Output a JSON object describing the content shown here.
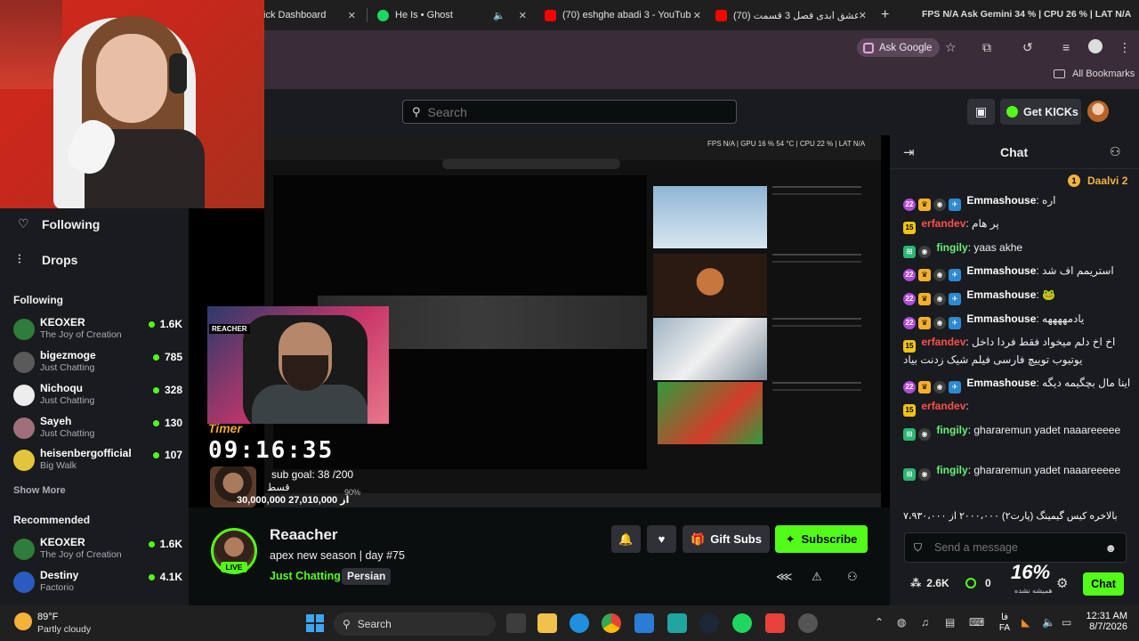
{
  "browser": {
    "tabs": [
      {
        "label": "ick Dashboard",
        "icon": "kick-icon"
      },
      {
        "label": "He Is • Ghost",
        "icon": "spotify-icon"
      },
      {
        "label": "(70) eshghe abadi 3 - YouTube",
        "icon": "youtube-icon"
      },
      {
        "label": "عشق ابدی فصل 3 قسمت (70)",
        "icon": "youtube-icon"
      }
    ],
    "perf_overlay": "FPS  N/A  Ask Gemini 34 %  |  CPU 26 %  |  LAT  N/A",
    "ask_google": "Ask Google",
    "all_bookmarks": "All Bookmarks"
  },
  "header": {
    "search_placeholder": "Search",
    "get_kicks": "Get KICKs"
  },
  "sidebar": {
    "nav": [
      {
        "label": "Following",
        "icon": "heart-icon"
      },
      {
        "label": "Drops",
        "icon": "drops-icon"
      }
    ],
    "following_title": "Following",
    "following": [
      {
        "name": "KEOXER",
        "category": "The Joy of Creation",
        "viewers": "1.6K",
        "color": "#2f7d3a"
      },
      {
        "name": "bigezmoge",
        "category": "Just Chatting",
        "viewers": "785",
        "color": "#5a5a5a"
      },
      {
        "name": "Nichoqu",
        "category": "Just Chatting",
        "viewers": "328",
        "color": "#ededed"
      },
      {
        "name": "Sayeh",
        "category": "Just Chatting",
        "viewers": "130",
        "color": "#a0707a"
      },
      {
        "name": "heisenbergofficial",
        "category": "Big Walk",
        "viewers": "107",
        "color": "#e2c53b"
      }
    ],
    "show_more": "Show More",
    "recommended_title": "Recommended",
    "recommended": [
      {
        "name": "KEOXER",
        "category": "The Joy of Creation",
        "viewers": "1.6K",
        "color": "#2f7d3a"
      },
      {
        "name": "Destiny",
        "category": "Factorio",
        "viewers": "4.1K",
        "color": "#2a5cc0"
      }
    ]
  },
  "stream": {
    "screen_perf": "FPS  N/A  |  GPU  16 %  54 °C  |  CPU  22 %  |  LAT  N/A",
    "timer_label": "Timer",
    "timer": "09:16:35",
    "sub_goal": "sub goal: 38 /200",
    "installment_label": "قسط",
    "goal_percent": "90%",
    "goal_amounts": "30,000,000 از 27,010,000",
    "cam_logo": "REACHER"
  },
  "channel": {
    "name": "Reaacher",
    "live_label": "LIVE",
    "title": "apex new season | day #75",
    "category": "Just Chatting",
    "tag": "Persian",
    "gift_subs": "Gift Subs",
    "subscribe": "Subscribe"
  },
  "chat": {
    "title": "Chat",
    "pinned_user": "Daalvi 2",
    "messages": [
      {
        "badges": [
          "sub",
          "crown",
          "mod",
          "vip"
        ],
        "user": "Emmashouse",
        "color": "u-white",
        "text": "اره"
      },
      {
        "badges": [
          "og"
        ],
        "user": "erfandev",
        "color": "u-red",
        "text": "پر هام"
      },
      {
        "badges": [
          "grn",
          "mod"
        ],
        "user": "fingily",
        "color": "u-green",
        "text": "yaas akhe"
      },
      {
        "badges": [
          "sub",
          "crown",
          "mod",
          "vip"
        ],
        "user": "Emmashouse",
        "color": "u-white",
        "text": "استریمم اف شد"
      },
      {
        "badges": [
          "sub",
          "crown",
          "mod",
          "vip"
        ],
        "user": "Emmashouse",
        "color": "u-white",
        "text": "🐸"
      },
      {
        "badges": [
          "sub",
          "crown",
          "mod",
          "vip"
        ],
        "user": "Emmashouse",
        "color": "u-white",
        "text": "یادمههههه"
      },
      {
        "badges": [
          "og"
        ],
        "user": "erfandev",
        "color": "u-red",
        "text": "اخ اخ دلم میخواد فقط فردا داخل یوتیوب توییچ فارسی فیلم شیک زدنت بیاد"
      },
      {
        "badges": [
          "sub",
          "crown",
          "mod",
          "vip"
        ],
        "user": "Emmashouse",
        "color": "u-white",
        "text": "اینا مال بچگیمه دیگه"
      },
      {
        "badges": [
          "og"
        ],
        "user": "erfandev",
        "color": "u-red",
        "text": ""
      },
      {
        "badges": [
          "grn",
          "mod"
        ],
        "user": "fingily",
        "color": "u-green",
        "text": "ghararemun yadet naaareeeee"
      },
      {
        "badges": [
          "grn",
          "mod"
        ],
        "user": "fingily",
        "color": "u-green",
        "text": "ghararemun yadet naaareeeee"
      }
    ],
    "emote_row": "بالاخره کیس گیمینگ (پارت۲) ۲۰۰۰،۰۰۰ از ۷،۹۳۰،۰۰۰",
    "send_placeholder": "Send a message",
    "kicks_count": "2.6K",
    "zero": "0",
    "percent": "16%",
    "percent_sub": "همیشه نشده",
    "chat_button": "Chat"
  },
  "taskbar": {
    "temp": "89°F",
    "weather": "Partly cloudy",
    "search": "Search",
    "lang_top": "فا",
    "lang_bottom": "FA",
    "time": "12:31 AM",
    "date": "8/7/2026"
  }
}
